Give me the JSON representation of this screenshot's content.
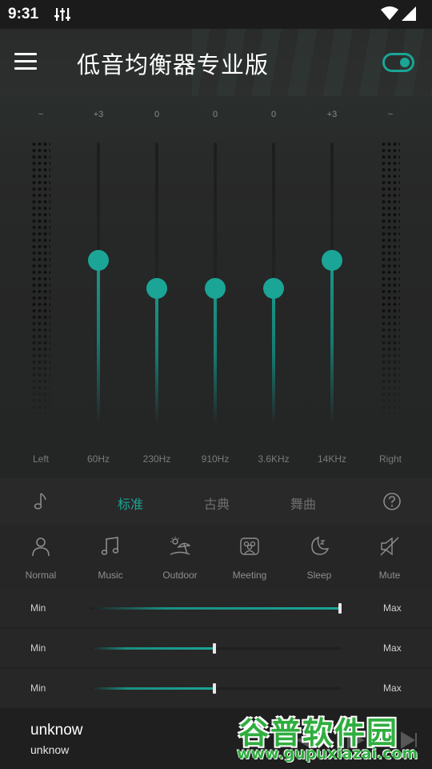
{
  "status_bar": {
    "time": "9:31"
  },
  "header": {
    "title": "低音均衡器专业版",
    "power_on": true
  },
  "equalizer": {
    "left_channel": {
      "label": "Left",
      "value": "~"
    },
    "right_channel": {
      "label": "Right",
      "value": "~"
    },
    "bands": [
      {
        "label": "60Hz",
        "value": "+3",
        "level": 0.58
      },
      {
        "label": "230Hz",
        "value": "0",
        "level": 0.48
      },
      {
        "label": "910Hz",
        "value": "0",
        "level": 0.48
      },
      {
        "label": "3.6KHz",
        "value": "0",
        "level": 0.48
      },
      {
        "label": "14KHz",
        "value": "+3",
        "level": 0.58
      }
    ]
  },
  "presets": {
    "tabs": [
      "标准",
      "古典",
      "舞曲"
    ],
    "active_index": 0
  },
  "modes": [
    {
      "label": "Normal",
      "icon": "person-icon"
    },
    {
      "label": "Music",
      "icon": "music-note-icon"
    },
    {
      "label": "Outdoor",
      "icon": "beach-icon"
    },
    {
      "label": "Meeting",
      "icon": "meeting-icon"
    },
    {
      "label": "Sleep",
      "icon": "moon-icon"
    },
    {
      "label": "Mute",
      "icon": "mute-icon"
    }
  ],
  "sliders": [
    {
      "min_label": "Min",
      "max_label": "Max",
      "level": 1.0
    },
    {
      "min_label": "Min",
      "max_label": "Max",
      "level": 0.5
    },
    {
      "min_label": "Min",
      "max_label": "Max",
      "level": 0.5
    }
  ],
  "now_playing": {
    "title": "unknow",
    "artist": "unknow"
  },
  "watermark": {
    "top": "谷普软件园",
    "bottom": "www.gupuxiazai.com"
  },
  "colors": {
    "accent": "#1aa596",
    "background": "#222222"
  }
}
